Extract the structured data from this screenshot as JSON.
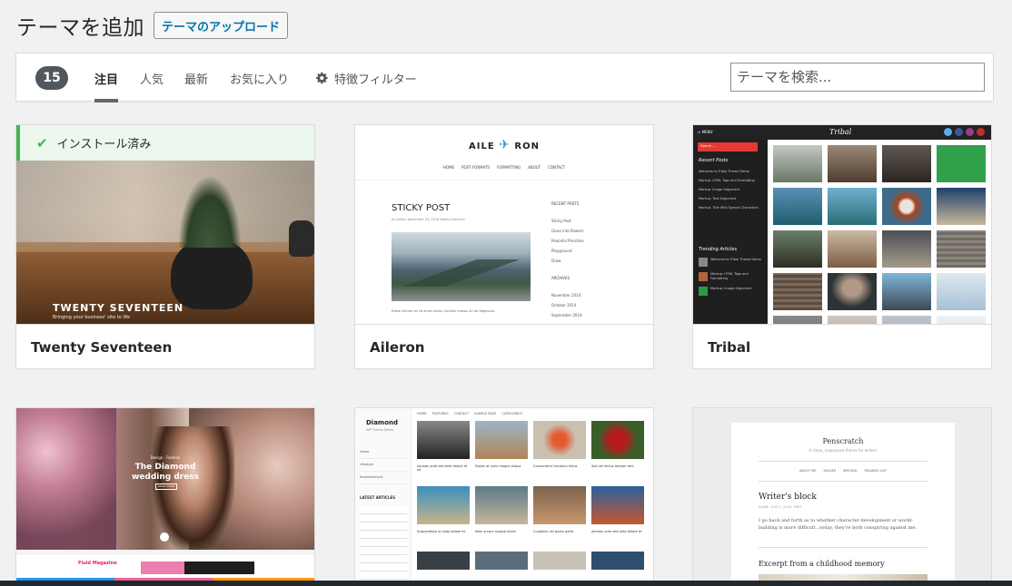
{
  "header": {
    "title": "テーマを追加",
    "upload_label": "テーマのアップロード"
  },
  "filter": {
    "count": "15",
    "tabs": [
      {
        "label": "注目",
        "active": true
      },
      {
        "label": "人気"
      },
      {
        "label": "最新"
      },
      {
        "label": "お気に入り"
      }
    ],
    "feature_filter_label": "特徴フィルター",
    "search_placeholder": "テーマを検索..."
  },
  "themes": [
    {
      "name": "Twenty Seventeen",
      "installed": true,
      "installed_label": "インストール済み",
      "preview": {
        "title": "TWENTY SEVENTEEN",
        "subtitle": "Bringing your business' site to life"
      }
    },
    {
      "name": "Aileron",
      "preview": {
        "logo_left": "AILE",
        "logo_right": "RON",
        "nav": [
          "HOME",
          "POST FORMATS",
          "FORMATTING",
          "ABOUT",
          "CONTACT"
        ],
        "post_title": "STICKY POST",
        "post_meta": "by admin  November 25, 2016  Books  Featured",
        "post_excerpt": "Etiam dictum an sit amet varius, facilisis massa ut nisi dignissim...",
        "sidebar_recent_heading": "RECENT POSTS",
        "sidebar_recent": [
          "Sticky Post",
          "Glass into flowers",
          "Peaceful Priorities",
          "Playground",
          "Draw"
        ],
        "sidebar_archives_heading": "ARCHIVES",
        "sidebar_archives": [
          "November 2014",
          "October 2014",
          "September 2014"
        ]
      }
    },
    {
      "name": "Tribal",
      "preview": {
        "menu_label": "≡ MENU",
        "logo": "Tribal",
        "search": "Search ...",
        "recent_heading": "Recent Posts",
        "recent": [
          "Welcome to Tribal Theme Demo",
          "Markup: HTML Tags and Formatting",
          "Markup: Image Alignment",
          "Markup: Text Alignment",
          "Markup: Title With Special Characters"
        ],
        "trending_heading": "Trending Articles",
        "trending": [
          "Welcome to Tribal Theme Demo",
          "Markup: HTML Tags and Formatting",
          "Markup: Image Alignment"
        ]
      }
    },
    {
      "name": "",
      "preview": {
        "title": "The Diamond wedding dress",
        "meta": "Design · Fashion",
        "button": "READ MORE",
        "brand": "Fluid Magazine"
      }
    },
    {
      "name": "",
      "preview": {
        "brand": "Diamond",
        "tagline": "WP Theme Demo",
        "nav": [
          "HOME",
          "FEATURES",
          "CONTACT",
          "SAMPLE PAGE",
          "CATEGORIES"
        ],
        "side": [
          "Home",
          "Lifestyle",
          "Entertainment"
        ],
        "latest_heading": "LATEST ARTICLES",
        "posts": [
          "Aenean ante sed ante dolore et sit",
          "Donec at nulla magna aliqua",
          "Consectetur tincidunt tellus",
          "Sed vel lectus tempor sem",
          "Suspendisse ut justo dolore et",
          "Nam ornare magna lorem",
          "Curabitur vel quam porta",
          "Aenean ante sed ante dolore et"
        ]
      }
    },
    {
      "name": "",
      "preview": {
        "title": "Penscratch",
        "tagline": "A clean, responsive theme for writers",
        "nav": [
          "ABOUT ME",
          "IMAGES",
          "WRITING",
          "READING LIST"
        ],
        "post1_title": "Writer's block",
        "post1_meta": "AUDIE · JULY 7, 2016 · EDIT",
        "post1_excerpt": "I go back and forth as to whether character development or world-building is more difficult...today, they're both conspiring against me.",
        "post2_title": "Excerpt from a childhood memory"
      }
    }
  ]
}
